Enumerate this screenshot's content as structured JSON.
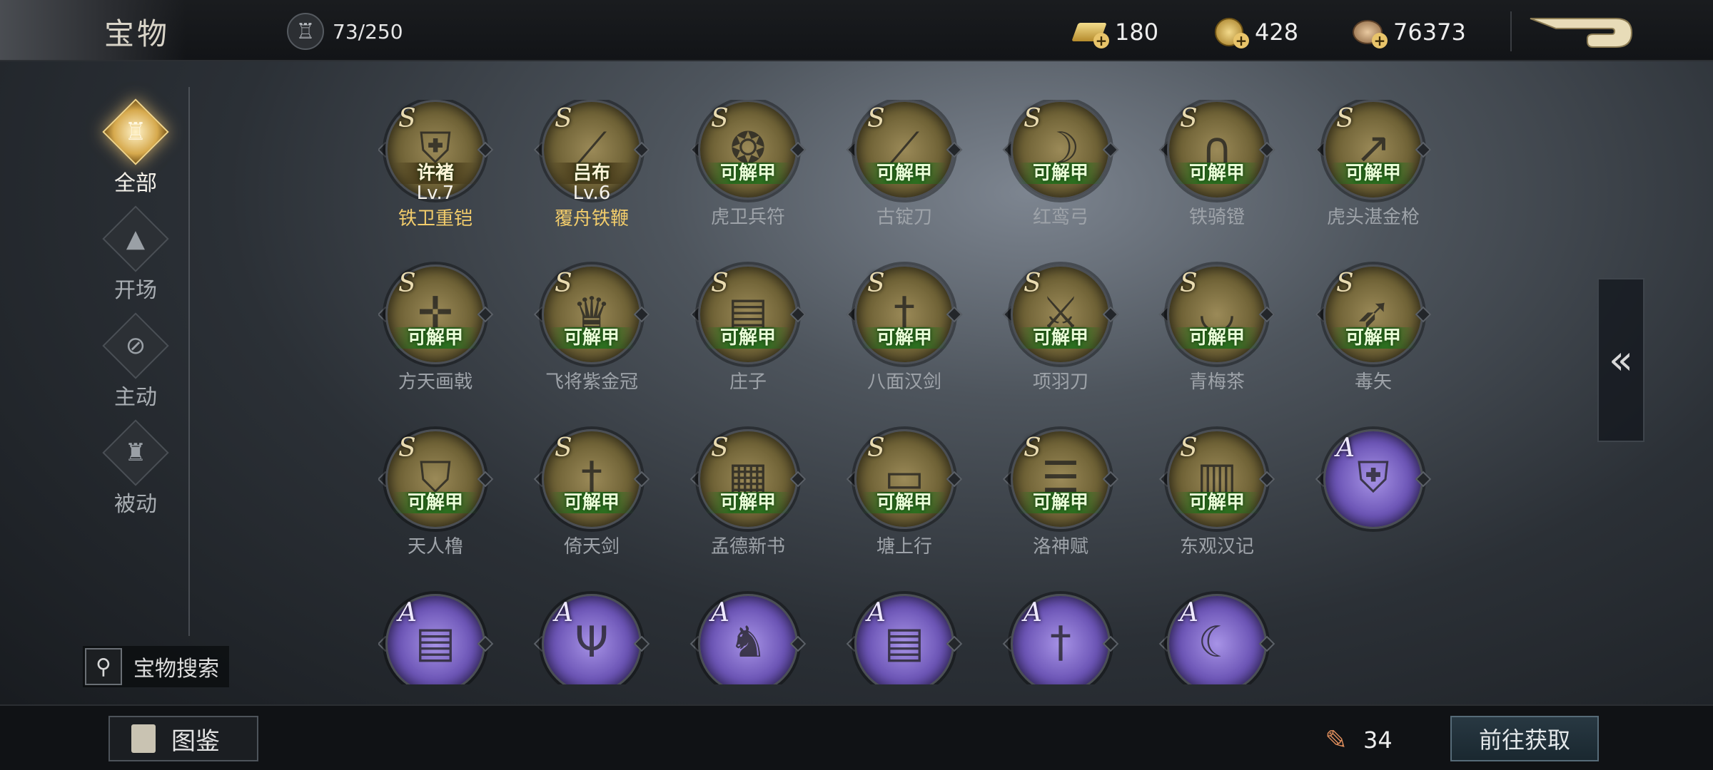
{
  "header": {
    "title": "宝物",
    "capacity": "73/250",
    "resources": [
      {
        "icon": "gold-ingot-icon",
        "value": "180"
      },
      {
        "icon": "gold-coin-icon",
        "value": "428"
      },
      {
        "icon": "copper-coin-icon",
        "value": "76373"
      }
    ],
    "back_icon": "back-arrow-icon"
  },
  "nav": [
    {
      "label": "全部",
      "icon": "cauldron-icon",
      "active": true
    },
    {
      "label": "开场",
      "icon": "pyramid-icon",
      "active": false
    },
    {
      "label": "主动",
      "icon": "strike-icon",
      "active": false
    },
    {
      "label": "被动",
      "icon": "helmet-icon",
      "active": false
    }
  ],
  "search": {
    "label": "宝物搜索",
    "icon": "search-icon"
  },
  "items": [
    {
      "grade": "S",
      "name": "铁卫重铠",
      "badge": "许褚",
      "level": "Lv.7",
      "owned": true,
      "icon": "armor-icon"
    },
    {
      "grade": "S",
      "name": "覆舟铁鞭",
      "badge": "吕布",
      "level": "Lv.6",
      "owned": true,
      "icon": "whip-icon"
    },
    {
      "grade": "S",
      "name": "虎卫兵符",
      "badge": "可解甲",
      "owned": false,
      "icon": "tiger-tally-icon"
    },
    {
      "grade": "S",
      "name": "古锭刀",
      "badge": "可解甲",
      "owned": false,
      "icon": "blade-icon"
    },
    {
      "grade": "S",
      "name": "红鸾弓",
      "badge": "可解甲",
      "owned": false,
      "icon": "bow-icon"
    },
    {
      "grade": "S",
      "name": "铁骑镫",
      "badge": "可解甲",
      "owned": false,
      "icon": "stirrup-icon"
    },
    {
      "grade": "S",
      "name": "虎头湛金枪",
      "badge": "可解甲",
      "owned": false,
      "icon": "spear-icon"
    },
    {
      "grade": "S",
      "name": "方天画戟",
      "badge": "可解甲",
      "owned": false,
      "icon": "halberd-icon"
    },
    {
      "grade": "S",
      "name": "飞将紫金冠",
      "badge": "可解甲",
      "owned": false,
      "icon": "crown-icon"
    },
    {
      "grade": "S",
      "name": "庄子",
      "badge": "可解甲",
      "owned": false,
      "icon": "book-icon"
    },
    {
      "grade": "S",
      "name": "八面汉剑",
      "badge": "可解甲",
      "owned": false,
      "icon": "sword-icon"
    },
    {
      "grade": "S",
      "name": "项羽刀",
      "badge": "可解甲",
      "owned": false,
      "icon": "sabre-icon"
    },
    {
      "grade": "S",
      "name": "青梅茶",
      "badge": "可解甲",
      "owned": false,
      "icon": "tea-bowl-icon"
    },
    {
      "grade": "S",
      "name": "毒矢",
      "badge": "可解甲",
      "owned": false,
      "icon": "arrow-icon"
    },
    {
      "grade": "S",
      "name": "天人橹",
      "badge": "可解甲",
      "owned": false,
      "icon": "shield-icon"
    },
    {
      "grade": "S",
      "name": "倚天剑",
      "badge": "可解甲",
      "owned": false,
      "icon": "sword-icon"
    },
    {
      "grade": "S",
      "name": "孟德新书",
      "badge": "可解甲",
      "owned": false,
      "icon": "scroll-box-icon"
    },
    {
      "grade": "S",
      "name": "塘上行",
      "badge": "可解甲",
      "owned": false,
      "icon": "paper-icon"
    },
    {
      "grade": "S",
      "name": "洛神赋",
      "badge": "可解甲",
      "owned": false,
      "icon": "scroll-icon"
    },
    {
      "grade": "S",
      "name": "东观汉记",
      "badge": "可解甲",
      "owned": false,
      "icon": "bamboo-book-icon"
    },
    {
      "grade": "A",
      "name": "",
      "badge": "",
      "owned": false,
      "icon": "armor-icon"
    },
    {
      "grade": "A",
      "name": "",
      "badge": "",
      "owned": false,
      "icon": "book-icon"
    },
    {
      "grade": "A",
      "name": "",
      "badge": "",
      "owned": false,
      "icon": "trident-icon"
    },
    {
      "grade": "A",
      "name": "",
      "badge": "",
      "owned": false,
      "icon": "robe-icon"
    },
    {
      "grade": "A",
      "name": "",
      "badge": "",
      "owned": false,
      "icon": "book-icon"
    },
    {
      "grade": "A",
      "name": "",
      "badge": "",
      "owned": false,
      "icon": "sword-icon"
    },
    {
      "grade": "A",
      "name": "",
      "badge": "",
      "owned": false,
      "icon": "glaive-icon"
    }
  ],
  "side_tab": {
    "glyph": "«",
    "icon": "collapse-left-icon"
  },
  "footer": {
    "guide_label": "图鉴",
    "token_count": "34",
    "token_icon": "feather-scroll-icon",
    "goto_label": "前往获取"
  }
}
